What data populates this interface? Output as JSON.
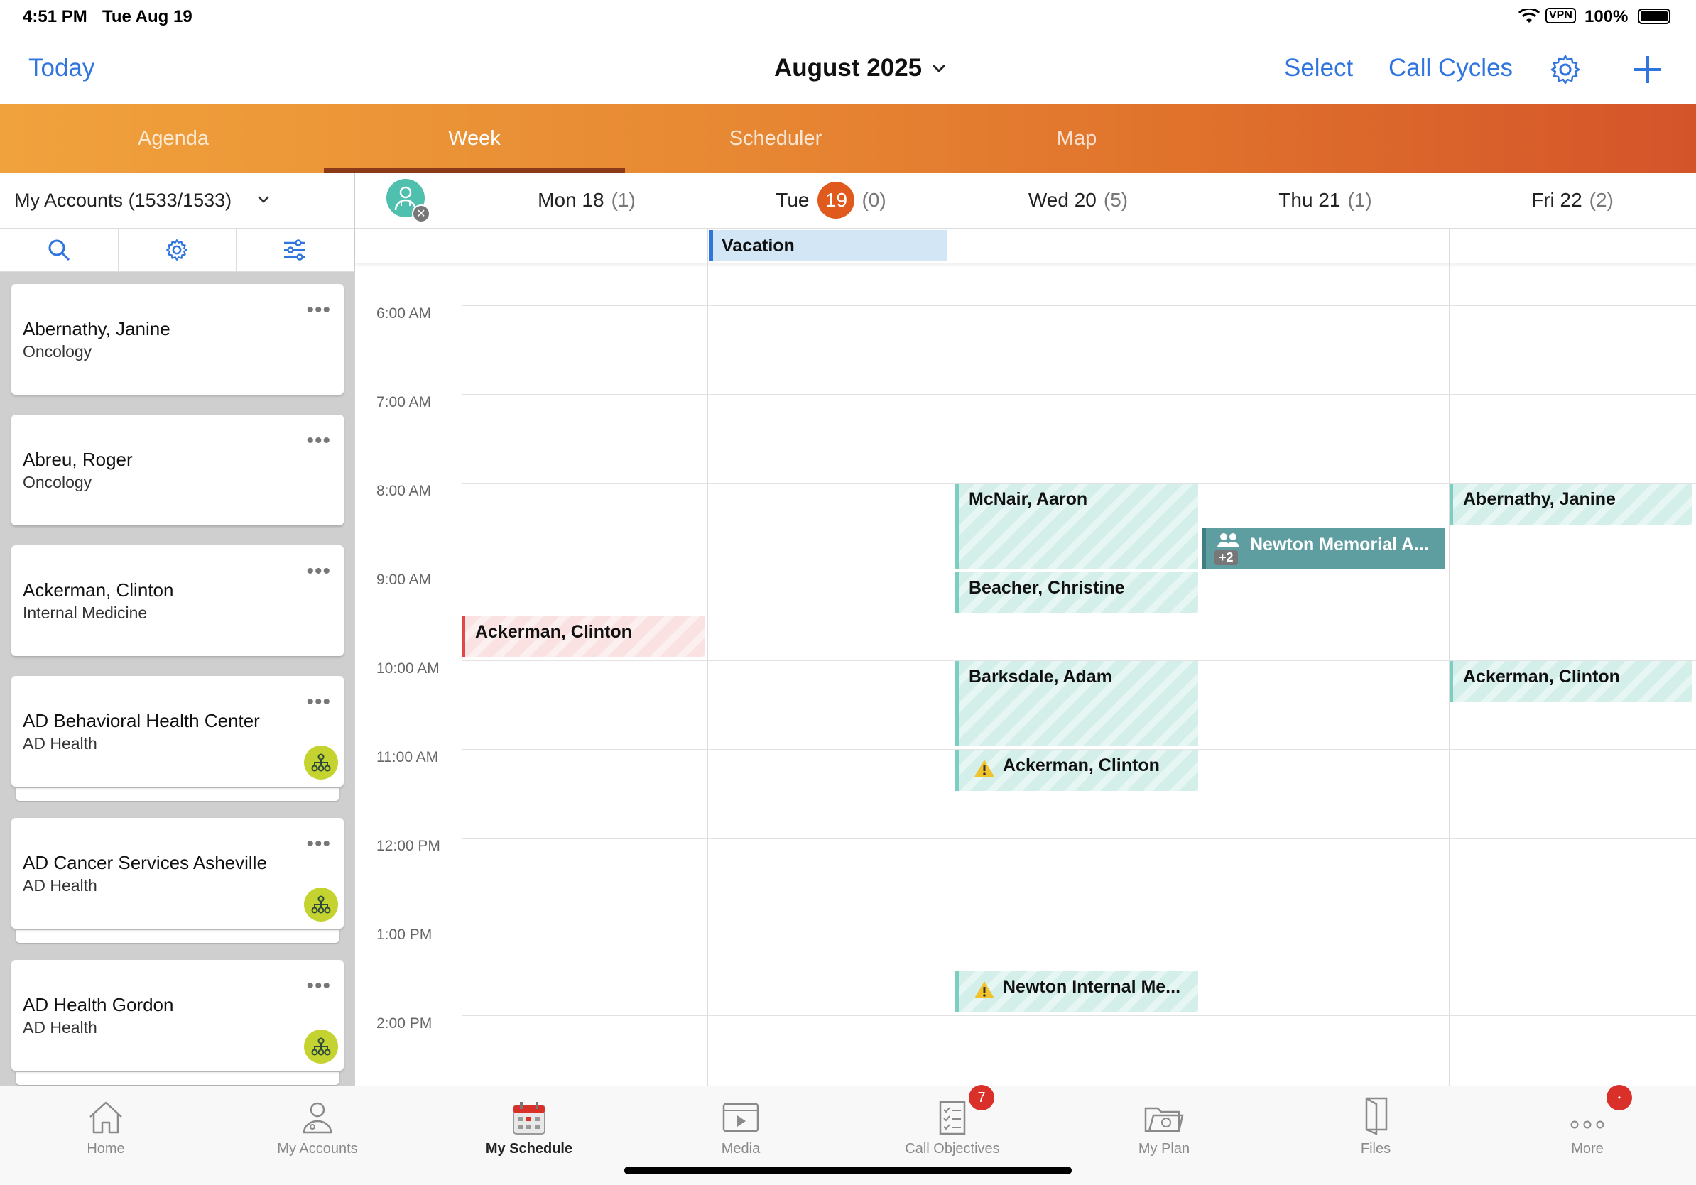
{
  "status_bar": {
    "time": "4:51 PM",
    "date": "Tue Aug 19",
    "vpn": "VPN",
    "battery": "100%"
  },
  "header": {
    "today_label": "Today",
    "month_title": "August 2025",
    "select_label": "Select",
    "call_cycles_label": "Call Cycles"
  },
  "tabs": [
    {
      "label": "Agenda"
    },
    {
      "label": "Week"
    },
    {
      "label": "Scheduler"
    },
    {
      "label": "Map"
    }
  ],
  "accounts": {
    "title": "My Accounts (1533/1533)",
    "items": [
      {
        "name": "Abernathy, Janine",
        "sub": "Oncology"
      },
      {
        "name": "Abreu, Roger",
        "sub": "Oncology"
      },
      {
        "name": "Ackerman, Clinton",
        "sub": "Internal Medicine"
      },
      {
        "name": "AD Behavioral Health Center",
        "sub": "AD Health"
      },
      {
        "name": "AD Cancer Services Asheville",
        "sub": "AD Health"
      },
      {
        "name": "AD Health Gordon",
        "sub": "AD Health"
      }
    ],
    "more_label": "•••"
  },
  "week": {
    "days": [
      {
        "label": "Mon 18",
        "count": "(1)"
      },
      {
        "label": "Tue",
        "num": "19",
        "count": "(0)"
      },
      {
        "label": "Wed 20",
        "count": "(5)"
      },
      {
        "label": "Thu 21",
        "count": "(1)"
      },
      {
        "label": "Fri 22",
        "count": "(2)"
      }
    ],
    "all_day": {
      "label": "Vacation"
    },
    "times": [
      "6:00 AM",
      "7:00 AM",
      "8:00 AM",
      "9:00 AM",
      "10:00 AM",
      "11:00 AM",
      "12:00 PM",
      "1:00 PM",
      "2:00 PM"
    ],
    "events": {
      "mon_1": "Ackerman, Clinton",
      "wed_1": "McNair, Aaron",
      "wed_2": "Beacher, Christine",
      "wed_3": "Barksdale, Adam",
      "wed_4": "Ackerman, Clinton",
      "wed_5": "Newton Internal Me...",
      "thu_1": "Newton Memorial A...",
      "thu_1_extra": "+2",
      "fri_1": "Abernathy, Janine",
      "fri_2": "Ackerman, Clinton"
    }
  },
  "bottom_nav": [
    {
      "label": "Home",
      "icon": "home-icon"
    },
    {
      "label": "My Accounts",
      "icon": "accounts-icon"
    },
    {
      "label": "My Schedule",
      "icon": "calendar-icon"
    },
    {
      "label": "Media",
      "icon": "media-icon"
    },
    {
      "label": "Call Objectives",
      "icon": "checklist-icon",
      "badge": "7"
    },
    {
      "label": "My Plan",
      "icon": "folder-icon"
    },
    {
      "label": "Files",
      "icon": "files-icon"
    },
    {
      "label": "More",
      "icon": "more-icon"
    }
  ],
  "colors": {
    "accent": "#2f74df",
    "today_badge": "#e05a1e",
    "event_teal": "#7ccfc0",
    "event_red": "#e04848",
    "thu_event": "#5f9ea0"
  }
}
